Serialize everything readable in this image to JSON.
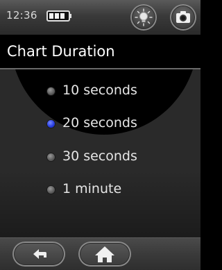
{
  "status_bar": {
    "time": "12:36",
    "battery_icon": "battery-icon",
    "brightness_icon": "brightness-icon",
    "camera_icon": "camera-icon"
  },
  "header": {
    "title": "Chart Duration"
  },
  "options": [
    {
      "label": "10 seconds",
      "selected": false
    },
    {
      "label": "20 seconds",
      "selected": true
    },
    {
      "label": "30 seconds",
      "selected": false
    },
    {
      "label": "1 minute",
      "selected": false
    }
  ],
  "nav": {
    "back_icon": "back-arrow-icon",
    "home_icon": "home-icon"
  },
  "colors": {
    "selected_radio": "#2a3fe0",
    "unselected_radio": "#6a6a6a",
    "text": "#e6e6e6"
  }
}
